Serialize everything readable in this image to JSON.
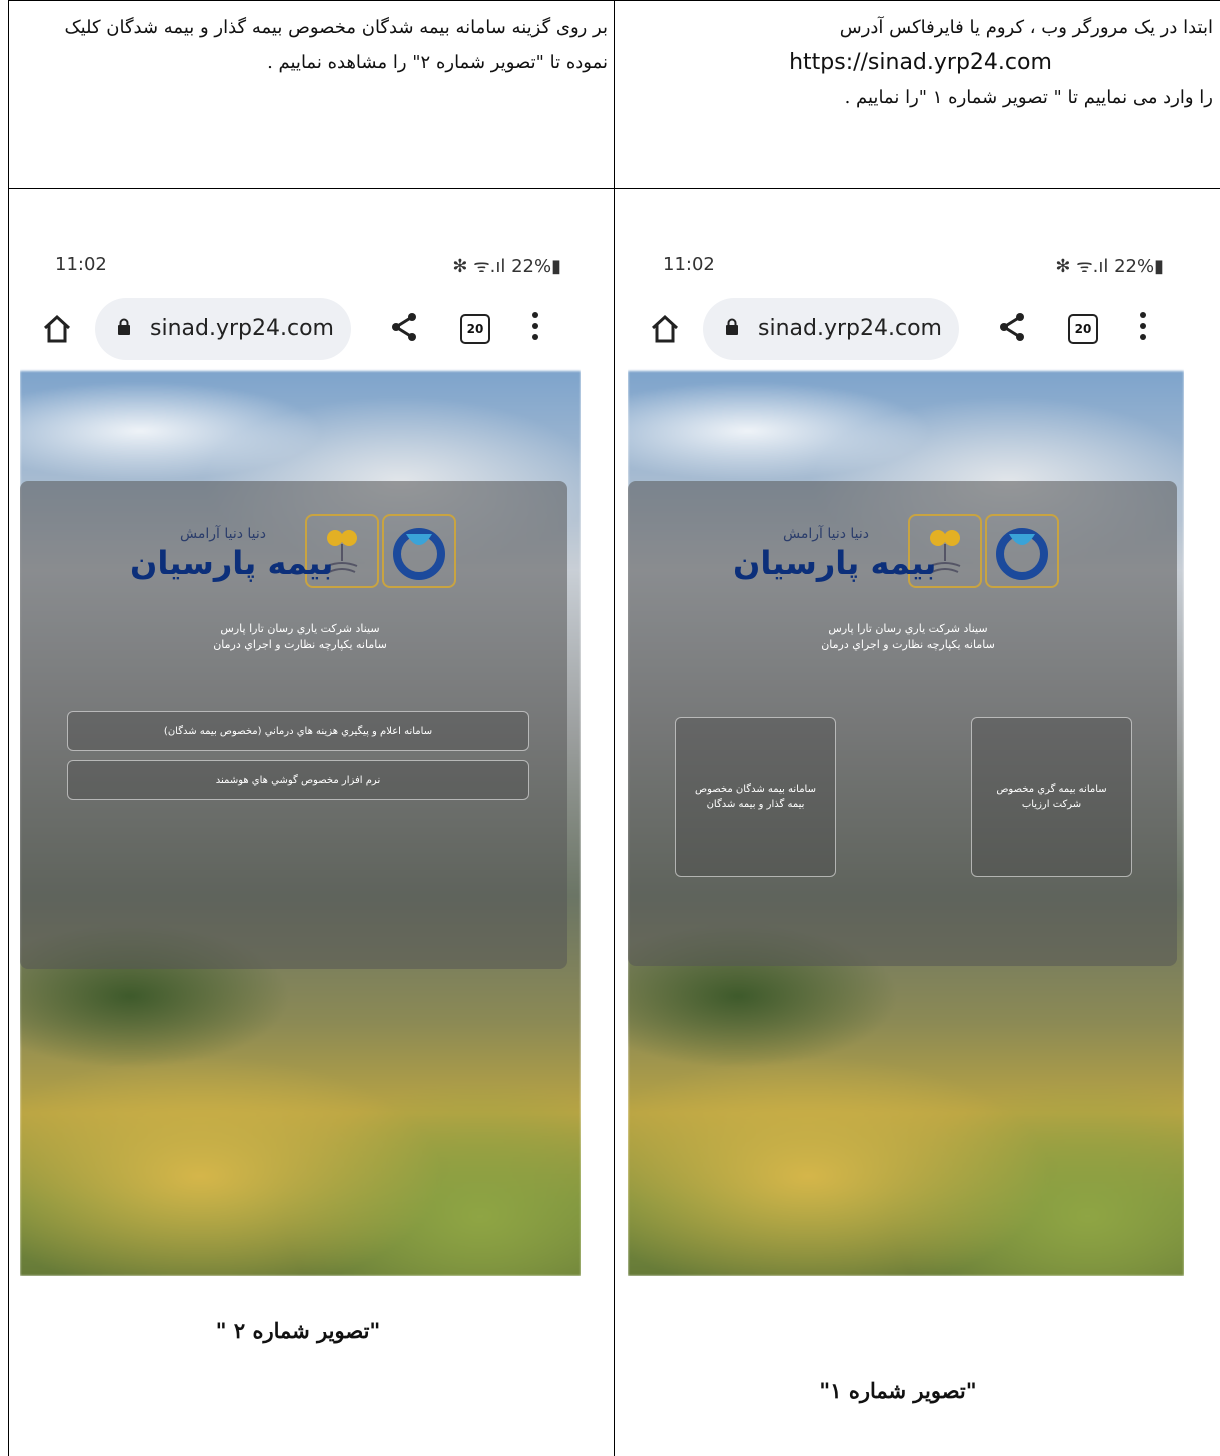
{
  "instructions": {
    "left_cell": "بر روی گزینه سامانه بیمه شدگان مخصوص بیمه گذار  و بیمه شدگان کلیک نموده تا \"تصویر شماره ۲\" را مشاهده نماییم .",
    "right_cell_line1": "ابتدا در یک مرورگر وب ، کروم یا فایرفاکس آدرس",
    "right_cell_url": "https://sinad.yrp24.com",
    "right_cell_line3": "را وارد می نماییم تا \" تصویر شماره ۱ \"را نماییم ."
  },
  "captions": {
    "left": "\"تصویر شماره ۲ \"",
    "right": "\"تصویر شماره ۱\""
  },
  "phone_left": {
    "time": "11:02",
    "status_right": "✻ ᯤ.ıl 22%▮",
    "url": "sinad.yrp24.com",
    "tab_count": "20",
    "brand": "بیمه پارسیان",
    "slogan": "دنیا دنیا آرامش",
    "desc_line1": "سيناد شركت ياري رسان تارا پارس",
    "desc_line2": "سامانه يكپارچه نظارت و اجراي درمان",
    "buttons": [
      "سامانه اعلام و پيگيري هزينه هاي درماني (مخصوص بيمه شدگان)",
      "نرم افزار مخصوص گوشي هاي هوشمند"
    ]
  },
  "phone_right": {
    "time": "11:02",
    "status_right": "✻ ᯤ.ıl 22%▮",
    "url": "sinad.yrp24.com",
    "tab_count": "20",
    "brand": "بیمه پارسیان",
    "slogan": "دنیا دنیا آرامش",
    "desc_line1": "سيناد شركت ياري رسان تارا پارس",
    "desc_line2": "سامانه يكپارچه نظارت و اجراي درمان",
    "card_left": "سامانه بیمه شدگان مخصوص بیمه گذار و بیمه شدگان",
    "card_right": "سامانه بيمه گري مخصوص شركت ارزياب"
  }
}
